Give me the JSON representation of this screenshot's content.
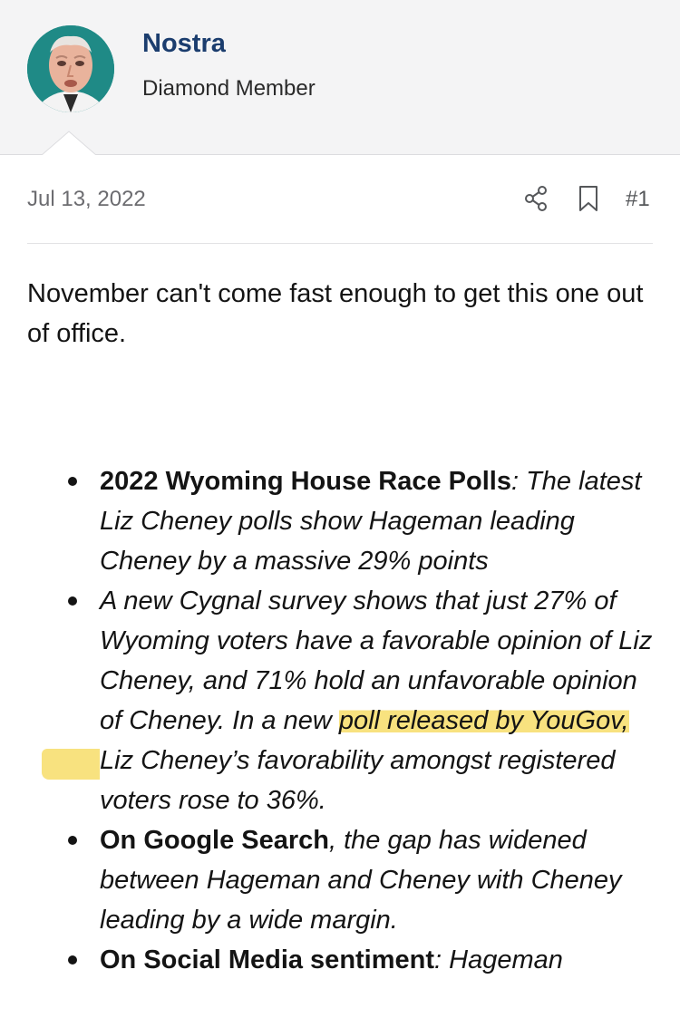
{
  "user": {
    "name": "Nostra",
    "title": "Diamond Member",
    "avatar_icon": "avatar-photo"
  },
  "post": {
    "date": "Jul 13, 2022",
    "number": "#1",
    "share_icon": "share-icon",
    "bookmark_icon": "bookmark-icon",
    "intro": "November can't come fast enough to get this one out of office."
  },
  "bullets": [
    {
      "bold": "2022 Wyoming House Race Polls",
      "sep": ": ",
      "italic": "The latest Liz Cheney polls show Hageman leading Cheney by a massive 29% points"
    },
    {
      "italic_a": "A new Cygnal survey shows that just 27% of Wyoming voters have a favorable opinion of Liz Cheney, and 71% hold an unfavorable opinion of Cheney. In a new ",
      "highlight": "poll released by YouGov,",
      "italic_b": " Liz Cheney’s favorability amongst registered voters rose to 36%."
    },
    {
      "bold": "On Google Search",
      "italic": ", the gap has widened between Hageman and Cheney with Cheney leading by a wide margin."
    },
    {
      "bold": "On Social Media sentiment",
      "italic": ": Hageman"
    }
  ],
  "colors": {
    "username": "#1b3d6e",
    "highlight": "#f8e27f",
    "header_bg": "#f4f4f5"
  }
}
